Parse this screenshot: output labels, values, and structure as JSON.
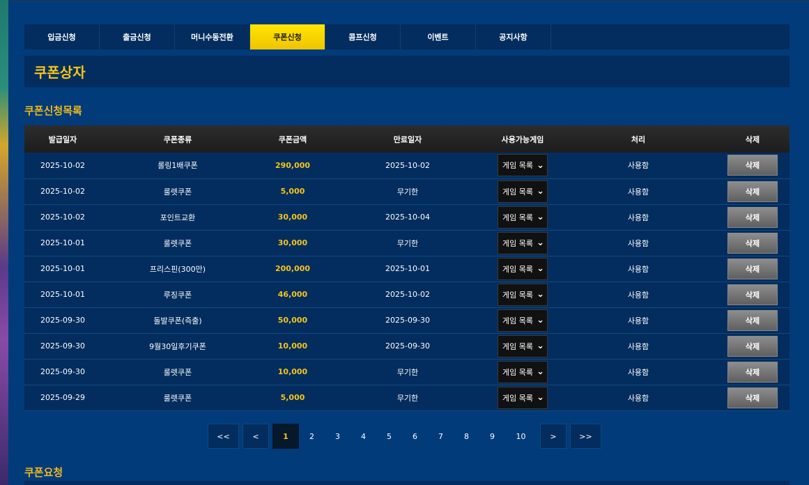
{
  "tabs": [
    {
      "label": "입금신청",
      "active": false
    },
    {
      "label": "출금신청",
      "active": false
    },
    {
      "label": "머니수동전환",
      "active": false
    },
    {
      "label": "쿠폰신청",
      "active": true
    },
    {
      "label": "콤프신청",
      "active": false
    },
    {
      "label": "이벤트",
      "active": false
    },
    {
      "label": "공지사항",
      "active": false
    }
  ],
  "page_title": "쿠폰상자",
  "list_section_title": "쿠폰신청목록",
  "table": {
    "headers": [
      "발급일자",
      "쿠폰종류",
      "쿠폰금액",
      "만료일자",
      "사용가능게임",
      "처리",
      "삭제"
    ],
    "rows": [
      {
        "issued": "2025-10-02",
        "type": "롤링1배쿠폰",
        "amount": "290,000",
        "expires": "2025-10-02",
        "game": "게임 목록",
        "status": "사용함",
        "delete": "삭제"
      },
      {
        "issued": "2025-10-02",
        "type": "룰렛쿠폰",
        "amount": "5,000",
        "expires": "무기한",
        "game": "게임 목록",
        "status": "사용함",
        "delete": "삭제"
      },
      {
        "issued": "2025-10-02",
        "type": "포인트교환",
        "amount": "30,000",
        "expires": "2025-10-04",
        "game": "게임 목록",
        "status": "사용함",
        "delete": "삭제"
      },
      {
        "issued": "2025-10-01",
        "type": "룰렛쿠폰",
        "amount": "30,000",
        "expires": "무기한",
        "game": "게임 목록",
        "status": "사용함",
        "delete": "삭제"
      },
      {
        "issued": "2025-10-01",
        "type": "프리스핀(300만)",
        "amount": "200,000",
        "expires": "2025-10-01",
        "game": "게임 목록",
        "status": "사용함",
        "delete": "삭제"
      },
      {
        "issued": "2025-10-01",
        "type": "루징쿠폰",
        "amount": "46,000",
        "expires": "2025-10-02",
        "game": "게임 목록",
        "status": "사용함",
        "delete": "삭제"
      },
      {
        "issued": "2025-09-30",
        "type": "돌발쿠폰(즉출)",
        "amount": "50,000",
        "expires": "2025-09-30",
        "game": "게임 목록",
        "status": "사용함",
        "delete": "삭제"
      },
      {
        "issued": "2025-09-30",
        "type": "9월30일후기쿠폰",
        "amount": "10,000",
        "expires": "2025-09-30",
        "game": "게임 목록",
        "status": "사용함",
        "delete": "삭제"
      },
      {
        "issued": "2025-09-30",
        "type": "룰렛쿠폰",
        "amount": "10,000",
        "expires": "무기한",
        "game": "게임 목록",
        "status": "사용함",
        "delete": "삭제"
      },
      {
        "issued": "2025-09-29",
        "type": "룰렛쿠폰",
        "amount": "5,000",
        "expires": "무기한",
        "game": "게임 목록",
        "status": "사용함",
        "delete": "삭제"
      }
    ]
  },
  "pagination": {
    "first": "<<",
    "prev": "<",
    "pages": [
      "1",
      "2",
      "3",
      "4",
      "5",
      "6",
      "7",
      "8",
      "9",
      "10"
    ],
    "current": "1",
    "next": ">",
    "last": ">>"
  },
  "request_section_title": "쿠폰요청",
  "colors": {
    "panel": "#013b7a",
    "dark_panel": "#032d5e",
    "accent_yellow": "#f5c518",
    "active_tab": "#ffe600"
  }
}
